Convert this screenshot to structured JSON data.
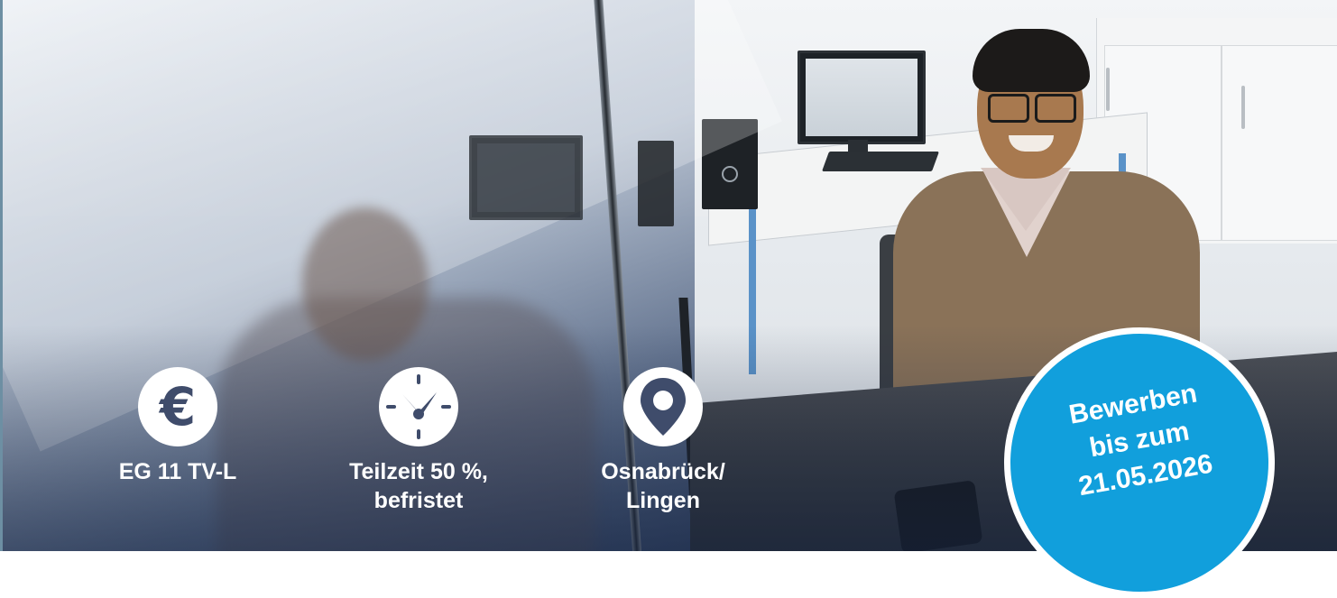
{
  "benefits": [
    {
      "icon": "euro-icon",
      "lines": [
        "EG 11 TV-L"
      ]
    },
    {
      "icon": "clock-icon",
      "lines": [
        "Teilzeit 50 %,",
        "befristet"
      ]
    },
    {
      "icon": "location-pin-icon",
      "lines": [
        "Osnabrück/",
        "Lingen"
      ]
    }
  ],
  "badge": {
    "lines": [
      "Bewerben",
      "bis zum",
      "21.05.2026"
    ]
  },
  "icons": {
    "euro_glyph": "€"
  },
  "colors": {
    "badge": "#119fdc",
    "icon_fill": "#3f4c6b",
    "text": "#ffffff"
  }
}
